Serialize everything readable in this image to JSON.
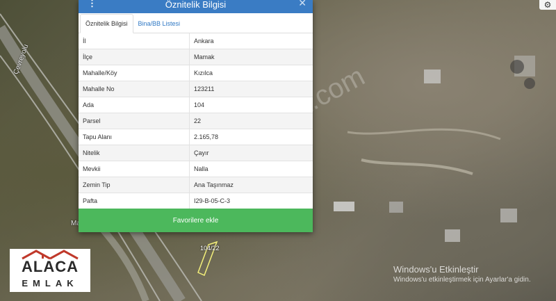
{
  "panel": {
    "title": "Öznitelik Bilgisi",
    "tabs": [
      {
        "label": "Öznitelik Bilgisi",
        "active": true
      },
      {
        "label": "Bina/BB Listesi",
        "active": false
      }
    ],
    "rows": [
      {
        "key": "İl",
        "value": "Ankara"
      },
      {
        "key": "İlçe",
        "value": "Mamak"
      },
      {
        "key": "Mahalle/Köy",
        "value": "Kızılca"
      },
      {
        "key": "Mahalle No",
        "value": "123211"
      },
      {
        "key": "Ada",
        "value": "104"
      },
      {
        "key": "Parsel",
        "value": "22"
      },
      {
        "key": "Tapu Alanı",
        "value": "2.165,78"
      },
      {
        "key": "Nitelik",
        "value": "Çayır"
      },
      {
        "key": "Mevkii",
        "value": "Nalla"
      },
      {
        "key": "Zemin Tip",
        "value": "Ana Taşınmaz"
      },
      {
        "key": "Pafta",
        "value": "I29-B-05-C-3"
      }
    ],
    "favorite_button": "Favorilere ekle"
  },
  "map": {
    "road_label": "Çevreyolu",
    "parcel_label": "104/22",
    "road_marker": "Ma"
  },
  "logo": {
    "word1": "ALACA",
    "word2": "EMLAK"
  },
  "watermark": "emlakjet.com",
  "windows_activation": {
    "title": "Windows'u Etkinleştir",
    "subtitle": "Windows'u etkinleştirmek için Ayarlar'a gidin."
  },
  "icons": {
    "settings": "gear-icon",
    "menu": "vertical-dots-icon",
    "close": "close-icon"
  },
  "colors": {
    "header": "#3a7cc4",
    "favorite": "#4cb85c"
  }
}
